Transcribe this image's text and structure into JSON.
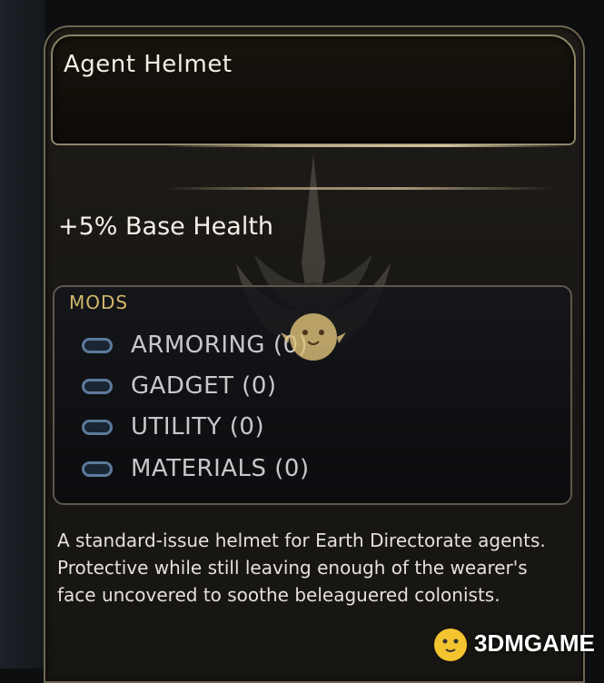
{
  "item": {
    "title": "Agent Helmet",
    "stat": "+5% Base Health"
  },
  "mods": {
    "heading": "MODS",
    "slots": [
      {
        "label": "ARMORING (0)",
        "icon": "mod-slot-icon"
      },
      {
        "label": "GADGET (0)",
        "icon": "mod-slot-icon"
      },
      {
        "label": "UTILITY (0)",
        "icon": "mod-slot-icon"
      },
      {
        "label": "MATERIALS (0)",
        "icon": "mod-slot-icon"
      }
    ]
  },
  "description": "A standard-issue helmet for Earth Directorate agents. Protective while still leaving enough of the wearer's face uncovered to soothe beleaguered colonists.",
  "watermark": {
    "text": "3DMGAME"
  },
  "colors": {
    "accent_gold": "#d2b86b",
    "frame": "#8e8468",
    "mod_icon": "#5c7a9c"
  }
}
